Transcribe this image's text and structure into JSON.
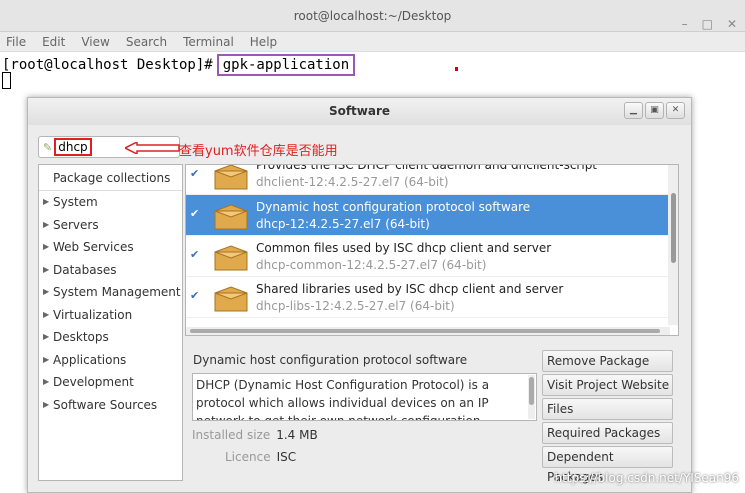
{
  "terminal": {
    "title": "root@localhost:~/Desktop",
    "menu": [
      "File",
      "Edit",
      "View",
      "Search",
      "Terminal",
      "Help"
    ],
    "prompt": "[root@localhost Desktop]#",
    "command": "gpk-application"
  },
  "window": {
    "title": "Software",
    "search_value": "dhcp",
    "annotation": "查看yum软件仓库是否能用",
    "categories_header": "Package collections",
    "categories": [
      "System",
      "Servers",
      "Web Services",
      "Databases",
      "System Management",
      "Virtualization",
      "Desktops",
      "Applications",
      "Development",
      "Software Sources"
    ],
    "packages": [
      {
        "summary": "Provides the ISC DHCP client daemon and dhclient-script",
        "name": "dhclient-12:4.2.5-27.el7 (64-bit)"
      },
      {
        "summary": "Dynamic host configuration protocol software",
        "name": "dhcp-12:4.2.5-27.el7 (64-bit)"
      },
      {
        "summary": "Common files used by ISC dhcp client and server",
        "name": "dhcp-common-12:4.2.5-27.el7 (64-bit)"
      },
      {
        "summary": "Shared libraries used by ISC dhcp client and server",
        "name": "dhcp-libs-12:4.2.5-27.el7 (64-bit)"
      }
    ],
    "detail": {
      "title": "Dynamic host configuration protocol software",
      "description": "DHCP (Dynamic Host Configuration Protocol) is a protocol which allows individual devices on an IP network to get their own network configuration information (IP address,",
      "installed_size_label": "Installed size",
      "installed_size": "1.4 MB",
      "licence_label": "Licence",
      "licence": "ISC"
    },
    "actions": [
      "Remove Package",
      "Visit Project Website",
      "Files",
      "Required Packages",
      "Dependent Packages"
    ]
  },
  "watermark": "https://blog.csdn.net/YISean96",
  "colors": {
    "selection": "#4a90d9",
    "annotation": "#e02020",
    "command_box": "#9b59b6"
  }
}
